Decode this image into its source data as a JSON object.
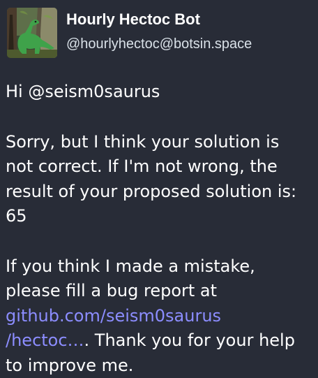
{
  "author": {
    "display_name": "Hourly Hectoc Bot",
    "account": "@hourlyhectoc@botsin.space",
    "avatar_icon": "green-dinosaur-avatar"
  },
  "message": {
    "greeting": "Hi @seism0saurus",
    "body_lines": [
      "Sorry, but I think your solution is",
      "not correct. If I'm not wrong, the",
      "result of your proposed solution is:",
      "65"
    ],
    "closing_lines": [
      "If you think I made a mistake,",
      "please fill a bug report at"
    ],
    "link_line_1": "github.com/seism0saurus",
    "link_line_2": "/hectoc…",
    "closing_tail_1": ". Thank you for your help",
    "closing_tail_2": "to improve me."
  },
  "colors": {
    "background": "#282c37",
    "text": "#ffffff",
    "secondary_text": "#d9e1e8",
    "link": "#8c8dff"
  }
}
